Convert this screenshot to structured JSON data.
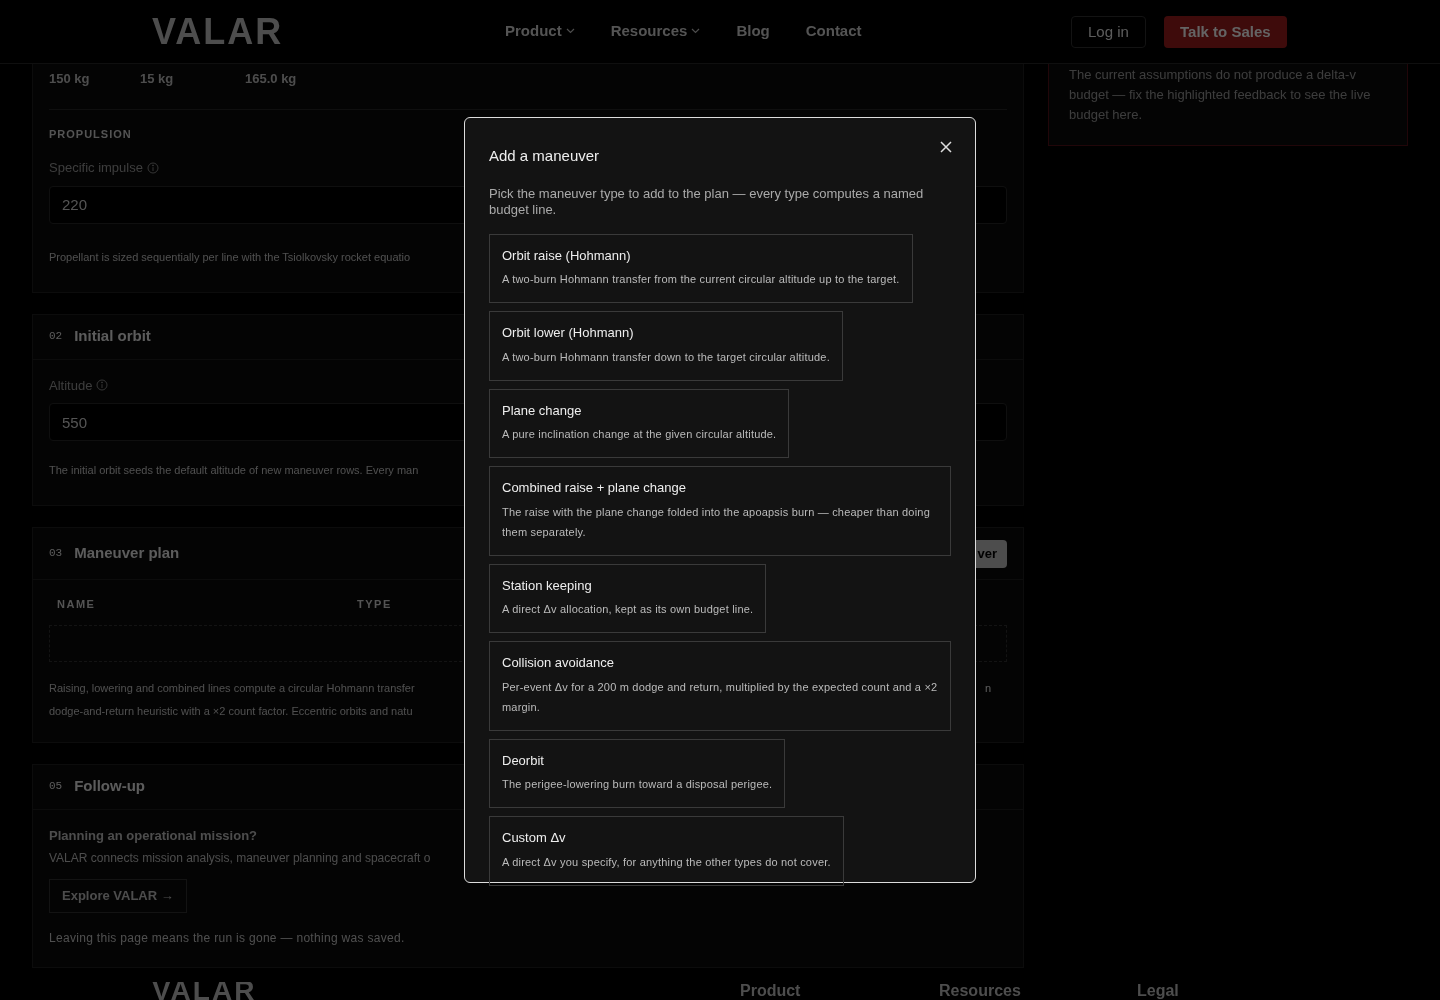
{
  "header": {
    "logo": "VALAR",
    "nav": [
      {
        "label": "Product",
        "dropdown": true
      },
      {
        "label": "Resources",
        "dropdown": true
      },
      {
        "label": "Blog",
        "dropdown": false
      },
      {
        "label": "Contact",
        "dropdown": false
      }
    ],
    "login": "Log in",
    "cta": "Talk to Sales"
  },
  "mass_card": {
    "values": [
      "150 kg",
      "15 kg",
      "165.0 kg"
    ],
    "section_label": "PROPULSION",
    "field_label": "Specific impulse",
    "field_value": "220",
    "note": "Propellant is sized sequentially per line with the Tsiolkovsky rocket equatio"
  },
  "initial_orbit": {
    "number": "02",
    "title": "Initial orbit",
    "field_label": "Altitude",
    "field_value": "550",
    "note": "The initial orbit seeds the default altitude of new maneuver rows. Every man"
  },
  "maneuver_plan": {
    "number": "03",
    "title": "Maneuver plan",
    "add_button": "ver",
    "columns": [
      "NAME",
      "TYPE"
    ],
    "note_lines": [
      "Raising, lowering and combined lines compute a circular Hohmann transfer",
      "dodge-and-return heuristic with a ×2 count factor. Eccentric orbits and natu"
    ],
    "note_tail": "n"
  },
  "follow_up": {
    "number": "05",
    "title": "Follow-up",
    "heading": "Planning an operational mission?",
    "text": "VALAR connects mission analysis, maneuver planning and spacecraft o",
    "button": "Explore VALAR →",
    "note": "Leaving this page means the run is gone — nothing was saved."
  },
  "budget_note": "The current assumptions do not produce a delta-v budget — fix the highlighted feedback to see the live budget here.",
  "modal": {
    "title": "Add a maneuver",
    "description": "Pick the maneuver type to add to the plan — every type computes a named budget line.",
    "options": [
      {
        "title": "Orbit raise (Hohmann)",
        "description": "A two-burn Hohmann transfer from the current circular altitude up to the target."
      },
      {
        "title": "Orbit lower (Hohmann)",
        "description": "A two-burn Hohmann transfer down to the target circular altitude."
      },
      {
        "title": "Plane change",
        "description": "A pure inclination change at the given circular altitude."
      },
      {
        "title": "Combined raise + plane change",
        "description": "The raise with the plane change folded into the apoapsis burn — cheaper than doing them separately."
      },
      {
        "title": "Station keeping",
        "description": "A direct Δv allocation, kept as its own budget line."
      },
      {
        "title": "Collision avoidance",
        "description": "Per-event Δv for a 200 m dodge and return, multiplied by the expected count and a ×2 margin."
      },
      {
        "title": "Deorbit",
        "description": "The perigee-lowering burn toward a disposal perigee."
      },
      {
        "title": "Custom Δv",
        "description": "A direct Δv you specify, for anything the other types do not cover."
      }
    ]
  },
  "footer": {
    "logo": "VALAR",
    "columns": [
      "Product",
      "Resources",
      "Legal"
    ]
  }
}
